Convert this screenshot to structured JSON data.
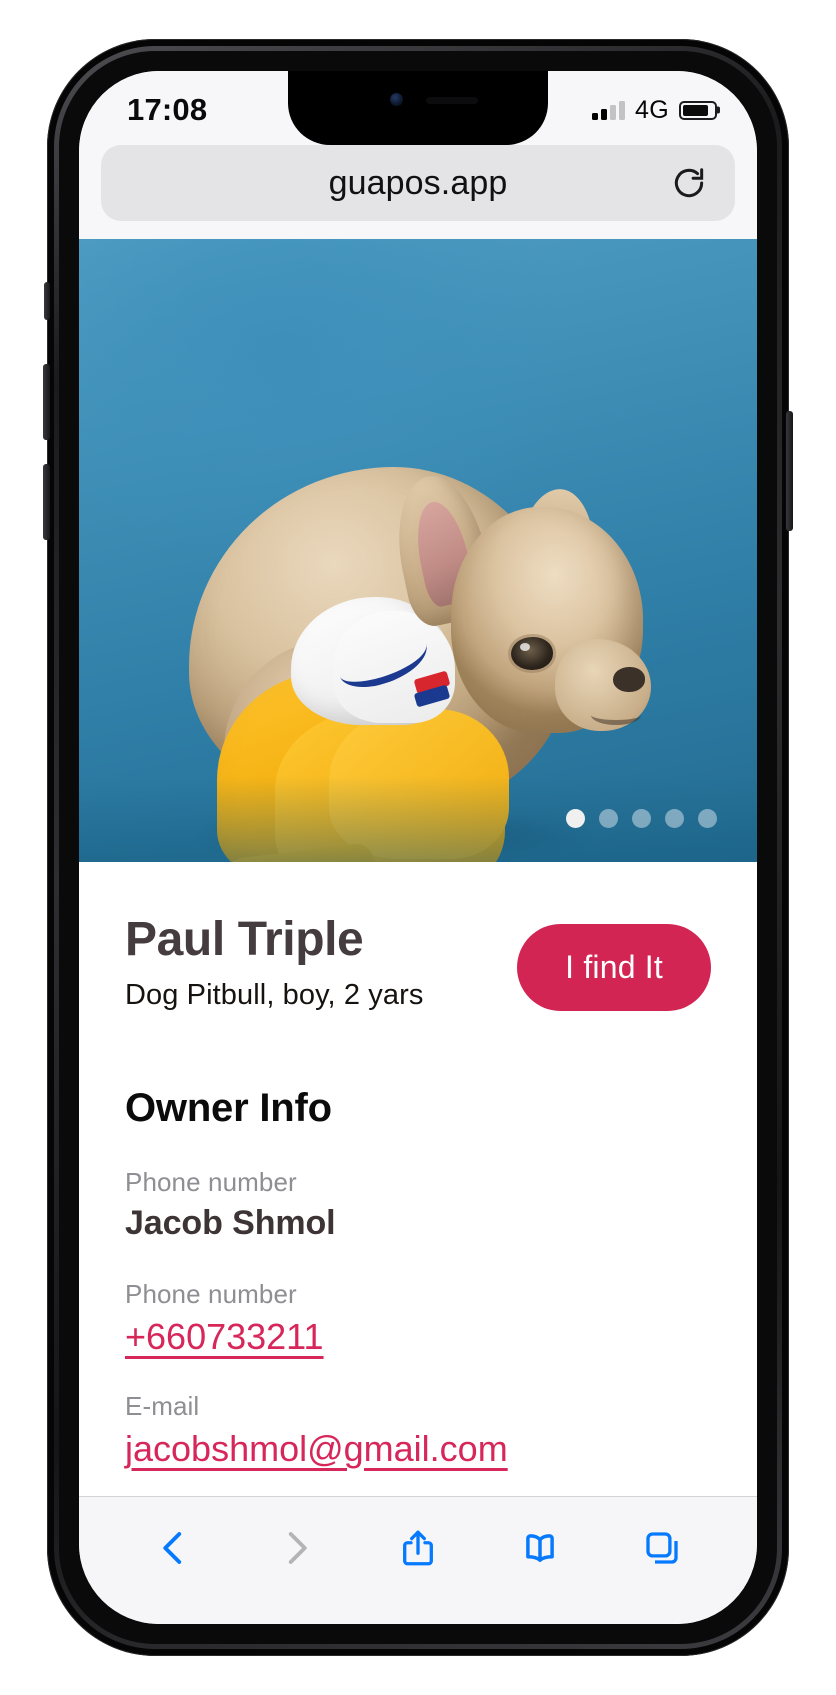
{
  "status_bar": {
    "time": "17:08",
    "network": "4G",
    "signal_bars_filled": 2,
    "signal_bars_total": 4,
    "battery_level_pct": 82
  },
  "browser": {
    "url": "guapos.app",
    "reload_icon": "reload-icon",
    "toolbar": {
      "back": "back-chevron-icon",
      "forward": "forward-chevron-icon",
      "share": "share-icon",
      "bookmarks": "book-icon",
      "tabs": "tabs-icon",
      "back_enabled": true,
      "forward_enabled": false
    }
  },
  "gallery": {
    "alt": "dog-photo",
    "total_slides": 5,
    "active_slide": 1
  },
  "pet": {
    "name": "Paul Triple",
    "meta": "Dog Pitbull, boy, 2 yars",
    "cta_label": "I find It"
  },
  "owner": {
    "section_title": "Owner Info",
    "fields": [
      {
        "label": "Phone number",
        "value": "Jacob Shmol",
        "type": "text"
      },
      {
        "label": "Phone number",
        "value": "+660733211",
        "type": "link"
      },
      {
        "label": "E-mail",
        "value": "jacobshmol@gmail.com",
        "type": "link"
      }
    ]
  },
  "colors": {
    "accent": "#d32553",
    "link": "#d6265a",
    "hero_bg": "#3f8fb7",
    "toolbar_tint": "#067aff",
    "muted_text": "#8e8e93"
  }
}
